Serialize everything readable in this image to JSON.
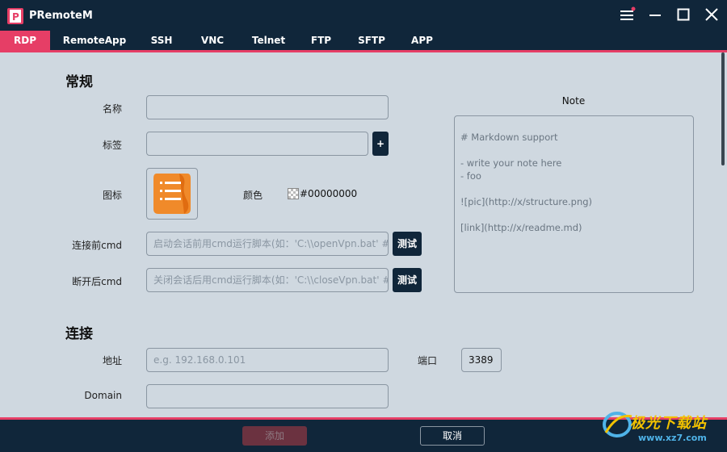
{
  "app": {
    "title": "PRemoteM"
  },
  "tabs": [
    "RDP",
    "RemoteApp",
    "SSH",
    "VNC",
    "Telnet",
    "FTP",
    "SFTP",
    "APP"
  ],
  "general": {
    "section_title": "常规",
    "name_label": "名称",
    "name_value": "",
    "tag_label": "标签",
    "tag_value": "",
    "tag_add_label": "+",
    "icon_label": "图标",
    "color_label": "颜色",
    "color_value": "#00000000",
    "pre_cmd_label": "连接前cmd",
    "pre_cmd_placeholder": "启动会话前用cmd运行脚本(如：'C:\\\\openVpn.bat' #",
    "post_cmd_label": "断开后cmd",
    "post_cmd_placeholder": "关闭会话后用cmd运行脚本(如：'C:\\\\closeVpn.bat' #",
    "test_label": "测试"
  },
  "note": {
    "title": "Note",
    "lines": [
      "# Markdown support",
      "",
      "- write your note here",
      "- foo",
      "",
      "![pic](http://x/structure.png)",
      "",
      "[link](http://x/readme.md)"
    ]
  },
  "connection": {
    "section_title": "连接",
    "address_label": "地址",
    "address_placeholder": "e.g. 192.168.0.101",
    "port_label": "端口",
    "port_value": "3389",
    "domain_label": "Domain",
    "domain_value": ""
  },
  "footer": {
    "add_label": "添加",
    "cancel_label": "取消"
  },
  "watermark": {
    "text": "极光下载站",
    "url": "www.xz7.com"
  },
  "colors": {
    "accent": "#e63e66",
    "titlebar": "#10263a",
    "content_bg": "#cfd8e0",
    "icon_orange": "#f08a2a"
  }
}
